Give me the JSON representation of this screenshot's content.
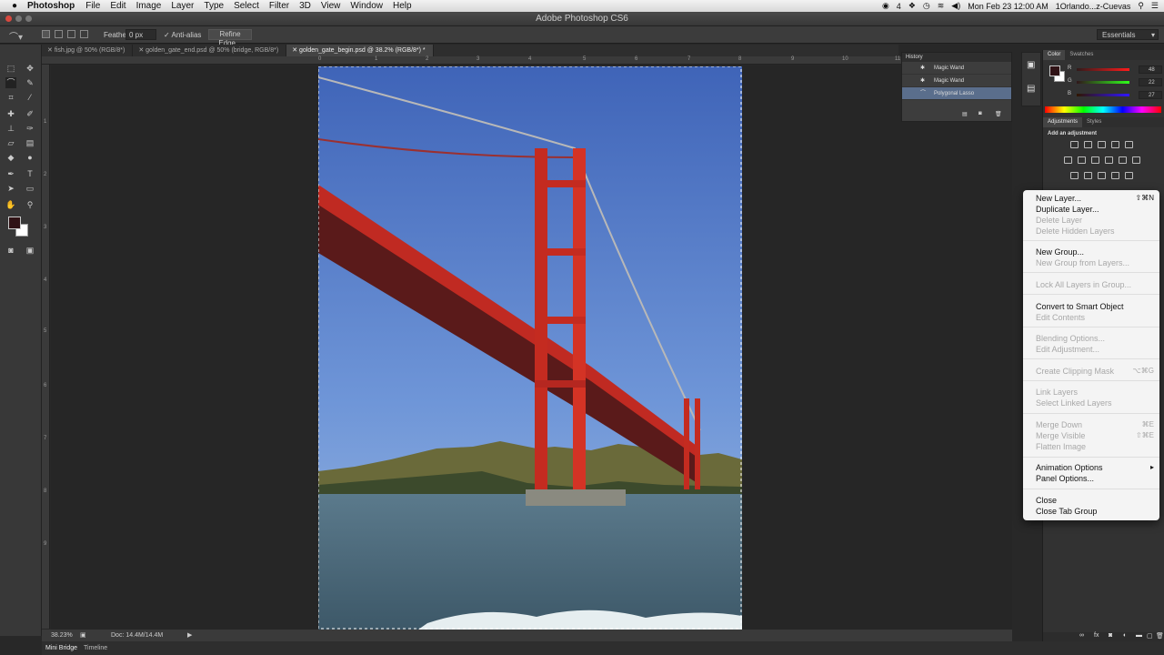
{
  "menubar": {
    "app_name": "Photoshop",
    "items": [
      "File",
      "Edit",
      "Image",
      "Layer",
      "Type",
      "Select",
      "Filter",
      "3D",
      "View",
      "Window",
      "Help"
    ],
    "battery_count": "4",
    "clock": "Mon Feb 23  12:00 AM",
    "user": "1Orlando...z-Cuevas"
  },
  "window": {
    "title": "Adobe Photoshop CS6"
  },
  "options": {
    "feather_label": "Feather:",
    "feather_value": "0 px",
    "antialias_label": "Anti-alias",
    "refine_edge": "Refine Edge...",
    "workspace": "Essentials"
  },
  "tabs": [
    {
      "label": "fish.jpg @ 50% (RGB/8*)"
    },
    {
      "label": "golden_gate_end.psd @ 50% (bridge, RGB/8*)"
    },
    {
      "label": "golden_gate_begin.psd @ 38.2% (RGB/8*) *"
    }
  ],
  "ruler_top": [
    "0",
    "1",
    "2",
    "3",
    "4",
    "5",
    "6",
    "7",
    "8",
    "9",
    "10",
    "11"
  ],
  "ruler_left": [
    "1",
    "2",
    "3",
    "4",
    "5",
    "6",
    "7",
    "8",
    "9"
  ],
  "status": {
    "zoom": "38.23%",
    "doc": "Doc: 14.4M/14.4M"
  },
  "bottom_tabs": [
    "Mini Bridge",
    "Timeline"
  ],
  "history": {
    "title": "History",
    "items": [
      {
        "label": "Magic Wand",
        "selected": false
      },
      {
        "label": "Magic Wand",
        "selected": false
      },
      {
        "label": "Polygonal Lasso",
        "selected": true
      }
    ]
  },
  "color_panel": {
    "tabs": [
      "Color",
      "Swatches"
    ],
    "channels": [
      {
        "name": "R",
        "value": "48",
        "color": "#e03030"
      },
      {
        "name": "G",
        "value": "22",
        "color": "#20c040"
      },
      {
        "name": "B",
        "value": "27",
        "color": "#3050e0"
      }
    ],
    "foreground": "#301316"
  },
  "adjustments_panel": {
    "tabs": [
      "Adjustments",
      "Styles"
    ],
    "subtitle": "Add an adjustment"
  },
  "context_menu": {
    "items": [
      {
        "label": "New Layer...",
        "shortcut": "⇧⌘N",
        "disabled": false
      },
      {
        "label": "Duplicate Layer...",
        "shortcut": "",
        "disabled": false
      },
      {
        "label": "Delete Layer",
        "shortcut": "",
        "disabled": true
      },
      {
        "label": "Delete Hidden Layers",
        "shortcut": "",
        "disabled": true
      },
      {
        "label": "New Group...",
        "shortcut": "",
        "disabled": false
      },
      {
        "label": "New Group from Layers...",
        "shortcut": "",
        "disabled": true
      },
      {
        "label": "Lock All Layers in Group...",
        "shortcut": "",
        "disabled": true
      },
      {
        "label": "Convert to Smart Object",
        "shortcut": "",
        "disabled": false
      },
      {
        "label": "Edit Contents",
        "shortcut": "",
        "disabled": true
      },
      {
        "label": "Blending Options...",
        "shortcut": "",
        "disabled": true
      },
      {
        "label": "Edit Adjustment...",
        "shortcut": "",
        "disabled": true
      },
      {
        "label": "Create Clipping Mask",
        "shortcut": "⌥⌘G",
        "disabled": true
      },
      {
        "label": "Link Layers",
        "shortcut": "",
        "disabled": true
      },
      {
        "label": "Select Linked Layers",
        "shortcut": "",
        "disabled": true
      },
      {
        "label": "Merge Down",
        "shortcut": "⌘E",
        "disabled": true
      },
      {
        "label": "Merge Visible",
        "shortcut": "⇧⌘E",
        "disabled": true
      },
      {
        "label": "Flatten Image",
        "shortcut": "",
        "disabled": true
      },
      {
        "label": "Animation Options",
        "shortcut": "▸",
        "disabled": false
      },
      {
        "label": "Panel Options...",
        "shortcut": "",
        "disabled": false
      },
      {
        "label": "Close",
        "shortcut": "",
        "disabled": false
      },
      {
        "label": "Close Tab Group",
        "shortcut": "",
        "disabled": false
      }
    ]
  }
}
